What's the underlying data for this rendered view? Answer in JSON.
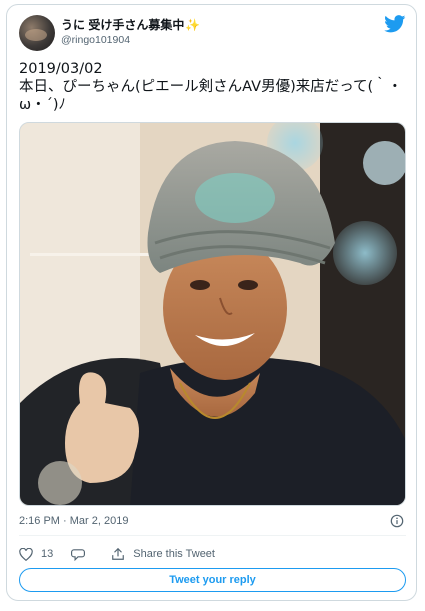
{
  "author": {
    "display_name": "うに 受け手さん募集中",
    "sparkle": "✨",
    "handle": "@ringo101904"
  },
  "tweet": {
    "lines": [
      "2019/03/02",
      "本日、ぴーちゃん(ピエール剣さんAV男優)来店だって(｀・",
      "ω・´)ﾉ"
    ]
  },
  "meta": {
    "timestamp": "2:16 PM · Mar 2, 2019"
  },
  "actions": {
    "like_count": "13",
    "share_label": "Share this Tweet"
  },
  "reply_button": "Tweet your reply",
  "icons": [
    "twitter-bird-icon",
    "info-icon",
    "heart-icon",
    "comment-icon",
    "share-icon"
  ],
  "colors": {
    "brand": "#1d9bf0",
    "text": "#0f1419",
    "muted": "#536471",
    "border": "#cfd9de"
  }
}
